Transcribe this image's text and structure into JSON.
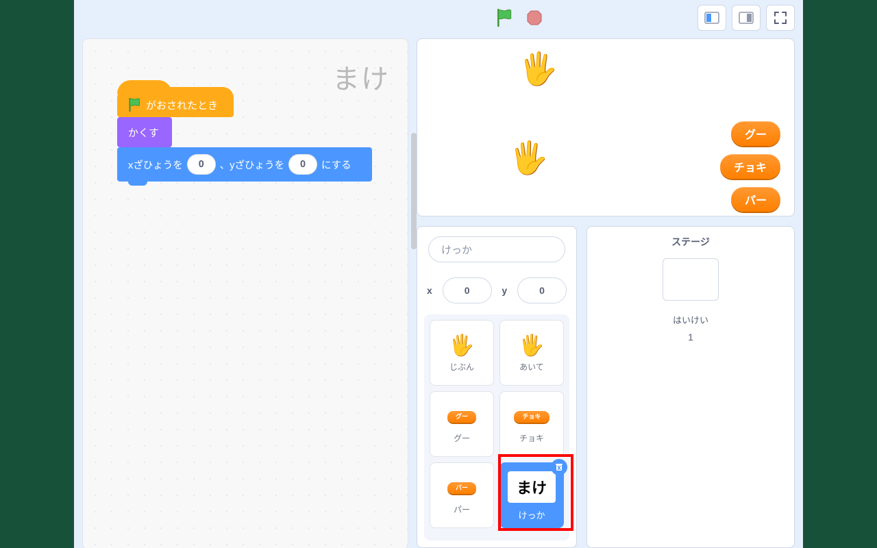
{
  "topbar": {
    "icons": {
      "flag": "green-flag-icon",
      "stop": "stop-sign-icon"
    }
  },
  "scripts": {
    "watermark": "まけ",
    "blocks": {
      "hat_label": "がおされたとき",
      "hide_label": "かくす",
      "goto_prefix": "xざひょうを",
      "goto_mid": "、yざひょうを",
      "goto_suffix": "にする",
      "x_val": "0",
      "y_val": "0"
    }
  },
  "stage": {
    "buttons": {
      "rock": "グー",
      "scissors": "チョキ",
      "paper": "パー"
    }
  },
  "sprite_info": {
    "name_placeholder": "けっか",
    "x_label": "x",
    "y_label": "y",
    "x_val": "0",
    "y_val": "0"
  },
  "sprites": {
    "jibun": "じぶん",
    "aite": "あいて",
    "guu_small": "グー",
    "guu_label": "グー",
    "choki_small": "チョキ",
    "choki_label": "チョキ",
    "paa_small": "パー",
    "paa_label": "パー",
    "kekka_text": "まけ",
    "kekka_label": "けっか"
  },
  "stage_panel": {
    "title": "ステージ",
    "backdrop_label": "はいけい",
    "backdrop_count": "1"
  }
}
